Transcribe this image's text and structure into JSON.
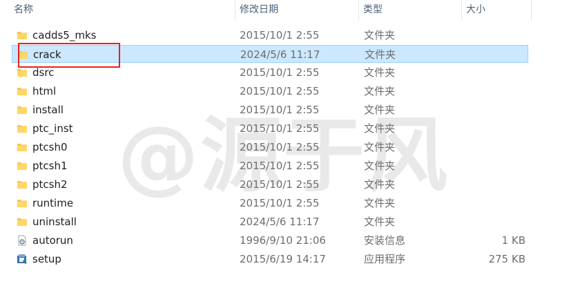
{
  "columns": {
    "name": "名称",
    "date": "修改日期",
    "type": "类型",
    "size": "大小"
  },
  "files": [
    {
      "name": "cadds5_mks",
      "date": "2015/10/1 2:55",
      "type": "文件夹",
      "size": "",
      "icon": "folder-icon"
    },
    {
      "name": "crack",
      "date": "2024/5/6 11:17",
      "type": "文件夹",
      "size": "",
      "icon": "folder-icon",
      "selected": true
    },
    {
      "name": "dsrc",
      "date": "2015/10/1 2:55",
      "type": "文件夹",
      "size": "",
      "icon": "folder-icon"
    },
    {
      "name": "html",
      "date": "2015/10/1 2:55",
      "type": "文件夹",
      "size": "",
      "icon": "folder-icon"
    },
    {
      "name": "install",
      "date": "2015/10/1 2:55",
      "type": "文件夹",
      "size": "",
      "icon": "folder-icon"
    },
    {
      "name": "ptc_inst",
      "date": "2015/10/1 2:55",
      "type": "文件夹",
      "size": "",
      "icon": "folder-icon"
    },
    {
      "name": "ptcsh0",
      "date": "2015/10/1 2:55",
      "type": "文件夹",
      "size": "",
      "icon": "folder-icon"
    },
    {
      "name": "ptcsh1",
      "date": "2015/10/1 2:55",
      "type": "文件夹",
      "size": "",
      "icon": "folder-icon"
    },
    {
      "name": "ptcsh2",
      "date": "2015/10/1 2:55",
      "type": "文件夹",
      "size": "",
      "icon": "folder-icon"
    },
    {
      "name": "runtime",
      "date": "2015/10/1 2:55",
      "type": "文件夹",
      "size": "",
      "icon": "folder-icon"
    },
    {
      "name": "uninstall",
      "date": "2024/5/6 11:17",
      "type": "文件夹",
      "size": "",
      "icon": "folder-icon"
    },
    {
      "name": "autorun",
      "date": "1996/9/10 21:06",
      "type": "安装信息",
      "size": "1 KB",
      "icon": "settings-file-icon"
    },
    {
      "name": "setup",
      "date": "2015/6/19 14:17",
      "type": "应用程序",
      "size": "275 KB",
      "icon": "setup-app-icon"
    }
  ],
  "watermark": "@源于风",
  "colors": {
    "selection_bg": "#cce8ff",
    "selection_border": "#99d1ff",
    "highlight": "#e52020",
    "folder": "#f4c44e"
  }
}
